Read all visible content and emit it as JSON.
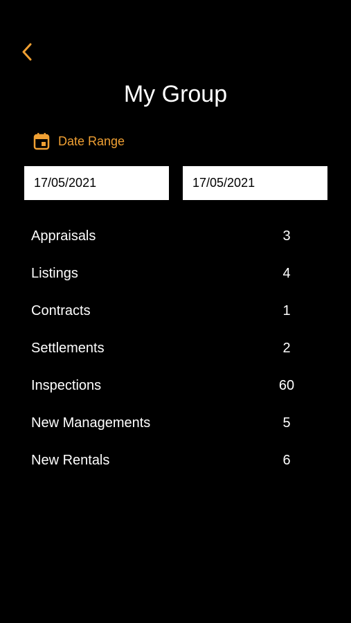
{
  "header": {
    "title": "My Group",
    "back_icon": "chevron-left-icon"
  },
  "colors": {
    "accent": "#f0a033",
    "background": "#000000",
    "field_background": "#ffffff"
  },
  "date_range": {
    "label": "Date Range",
    "icon": "calendar-icon",
    "start_date": "17/05/2021",
    "end_date": "17/05/2021"
  },
  "stats": [
    {
      "label": "Appraisals",
      "value": "3"
    },
    {
      "label": "Listings",
      "value": "4"
    },
    {
      "label": "Contracts",
      "value": "1"
    },
    {
      "label": "Settlements",
      "value": "2"
    },
    {
      "label": "Inspections",
      "value": "60"
    },
    {
      "label": "New Managements",
      "value": "5"
    },
    {
      "label": "New Rentals",
      "value": "6"
    }
  ]
}
